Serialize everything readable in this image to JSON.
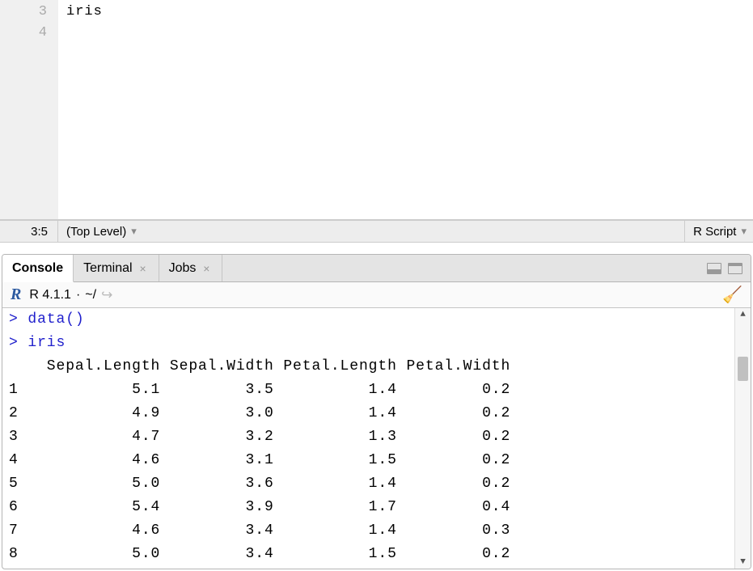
{
  "editor": {
    "lines": [
      {
        "num": "3",
        "content": "iris"
      },
      {
        "num": "4",
        "content": ""
      }
    ]
  },
  "status": {
    "position": "3:5",
    "scope": "(Top Level)",
    "language": "R Script"
  },
  "tabs": {
    "console": "Console",
    "terminal": "Terminal",
    "jobs": "Jobs"
  },
  "console_header": {
    "r_letter": "R",
    "version": "R 4.1.1",
    "separator": "·",
    "path": "~/"
  },
  "chart_data": {
    "type": "table",
    "title": "iris",
    "columns": [
      "Sepal.Length",
      "Sepal.Width",
      "Petal.Length",
      "Petal.Width"
    ],
    "rows": [
      {
        "idx": "1",
        "vals": [
          "5.1",
          "3.5",
          "1.4",
          "0.2"
        ]
      },
      {
        "idx": "2",
        "vals": [
          "4.9",
          "3.0",
          "1.4",
          "0.2"
        ]
      },
      {
        "idx": "3",
        "vals": [
          "4.7",
          "3.2",
          "1.3",
          "0.2"
        ]
      },
      {
        "idx": "4",
        "vals": [
          "4.6",
          "3.1",
          "1.5",
          "0.2"
        ]
      },
      {
        "idx": "5",
        "vals": [
          "5.0",
          "3.6",
          "1.4",
          "0.2"
        ]
      },
      {
        "idx": "6",
        "vals": [
          "5.4",
          "3.9",
          "1.7",
          "0.4"
        ]
      },
      {
        "idx": "7",
        "vals": [
          "4.6",
          "3.4",
          "1.4",
          "0.3"
        ]
      },
      {
        "idx": "8",
        "vals": [
          "5.0",
          "3.4",
          "1.5",
          "0.2"
        ]
      }
    ]
  },
  "console_lines": {
    "l1": "> data()",
    "l2": "> iris"
  }
}
